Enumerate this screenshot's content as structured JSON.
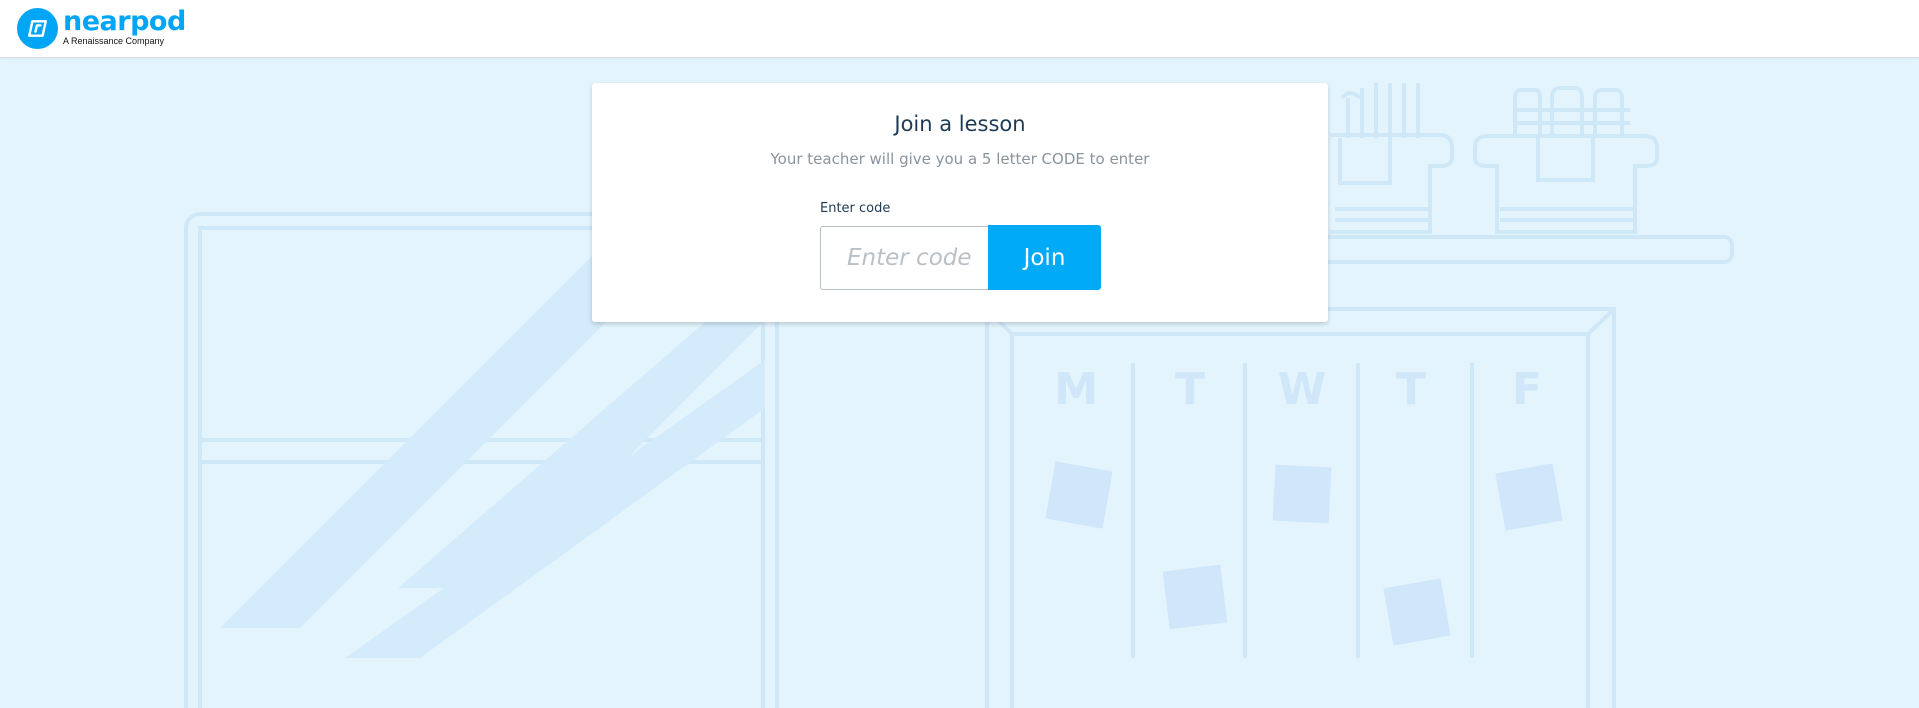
{
  "brand": {
    "name": "nearpod",
    "tagline": "A Renaissance Company",
    "color": "#00a5f6",
    "icon": "nearpod-logo-icon"
  },
  "join_card": {
    "title": "Join a lesson",
    "subtitle": "Your teacher will give you a 5 letter CODE to enter",
    "code_label": "Enter code",
    "code_placeholder": "Enter code",
    "code_value": "",
    "join_label": "Join",
    "join_color": "#00aaf7"
  },
  "background": {
    "color": "#e3f4fd",
    "calendar_days": [
      "M",
      "T",
      "W",
      "T",
      "F"
    ]
  }
}
